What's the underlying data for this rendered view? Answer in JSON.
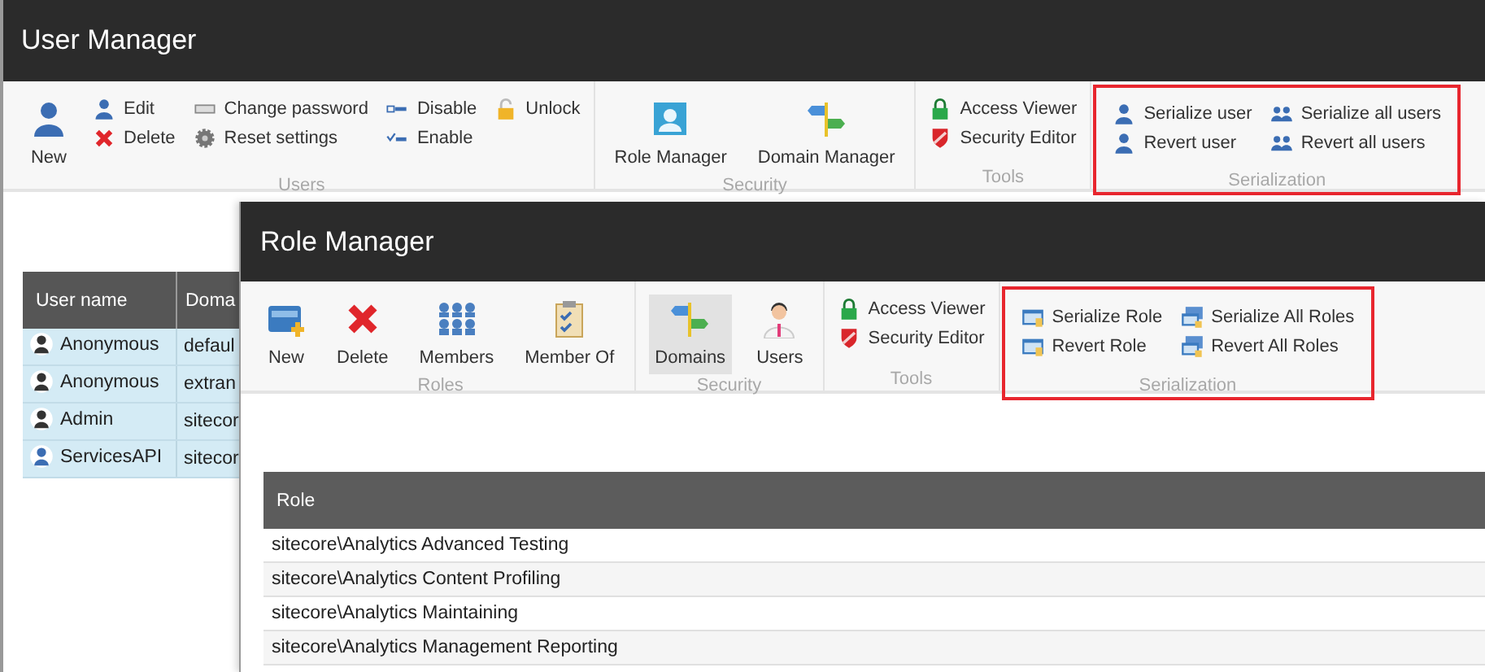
{
  "windows": [
    {
      "title": "User Manager",
      "ribbon": [
        {
          "label": "Users",
          "highlighted": false,
          "columns": [
            [
              {
                "kind": "large",
                "label": "New"
              }
            ],
            [
              {
                "kind": "small",
                "label": "Edit"
              },
              {
                "kind": "small",
                "label": "Delete"
              }
            ],
            [
              {
                "kind": "small",
                "label": "Change password"
              },
              {
                "kind": "small",
                "label": "Reset settings"
              }
            ],
            [
              {
                "kind": "small",
                "label": "Disable"
              },
              {
                "kind": "small",
                "label": "Enable"
              }
            ],
            [
              {
                "kind": "small",
                "label": "Unlock"
              }
            ]
          ]
        },
        {
          "label": "Security",
          "highlighted": false,
          "columns": [
            [
              {
                "kind": "large",
                "label": "Role Manager"
              }
            ],
            [
              {
                "kind": "large",
                "label": "Domain Manager"
              }
            ]
          ]
        },
        {
          "label": "Tools",
          "highlighted": false,
          "columns": [
            [
              {
                "kind": "small",
                "label": "Access Viewer"
              },
              {
                "kind": "small",
                "label": "Security Editor"
              }
            ]
          ]
        },
        {
          "label": "Serialization",
          "highlighted": true,
          "columns": [
            [
              {
                "kind": "small",
                "label": "Serialize user"
              },
              {
                "kind": "small",
                "label": "Revert user"
              }
            ],
            [
              {
                "kind": "small",
                "label": "Serialize all users"
              },
              {
                "kind": "small",
                "label": "Revert all users"
              }
            ]
          ]
        }
      ],
      "table": {
        "columns": [
          "User name",
          "Doma"
        ],
        "rows": [
          {
            "color": "#333333",
            "cells": [
              "Anonymous",
              "defaul"
            ]
          },
          {
            "color": "#333333",
            "cells": [
              "Anonymous",
              "extran"
            ]
          },
          {
            "color": "#333333",
            "cells": [
              "Admin",
              "sitecor"
            ]
          },
          {
            "color": "#3b6db3",
            "cells": [
              "ServicesAPI",
              "sitecor"
            ]
          }
        ]
      }
    },
    {
      "title": "Role Manager",
      "ribbon": [
        {
          "label": "Roles",
          "highlighted": false,
          "columns": [
            [
              {
                "kind": "large",
                "label": "New"
              }
            ],
            [
              {
                "kind": "large",
                "label": "Delete"
              }
            ],
            [
              {
                "kind": "large",
                "label": "Members"
              }
            ],
            [
              {
                "kind": "large",
                "label": "Member Of"
              }
            ]
          ]
        },
        {
          "label": "Security",
          "highlighted": false,
          "columns": [
            [
              {
                "kind": "large",
                "label": "Domains",
                "selected": true
              }
            ],
            [
              {
                "kind": "large",
                "label": "Users",
                "selected": false
              }
            ]
          ]
        },
        {
          "label": "Tools",
          "highlighted": false,
          "columns": [
            [
              {
                "kind": "small",
                "label": "Access Viewer"
              },
              {
                "kind": "small",
                "label": "Security Editor"
              }
            ]
          ]
        },
        {
          "label": "Serialization",
          "highlighted": true,
          "columns": [
            [
              {
                "kind": "small",
                "label": "Serialize Role"
              },
              {
                "kind": "small",
                "label": "Revert Role"
              }
            ],
            [
              {
                "kind": "small",
                "label": "Serialize All Roles"
              },
              {
                "kind": "small",
                "label": "Revert All Roles"
              }
            ]
          ]
        }
      ],
      "table": {
        "columns": [
          "Role"
        ],
        "rows": [
          {
            "cells": [
              "sitecore\\Analytics Advanced Testing"
            ]
          },
          {
            "cells": [
              "sitecore\\Analytics Content Profiling"
            ]
          },
          {
            "cells": [
              "sitecore\\Analytics Maintaining"
            ]
          },
          {
            "cells": [
              "sitecore\\Analytics Management Reporting"
            ]
          }
        ]
      }
    }
  ]
}
